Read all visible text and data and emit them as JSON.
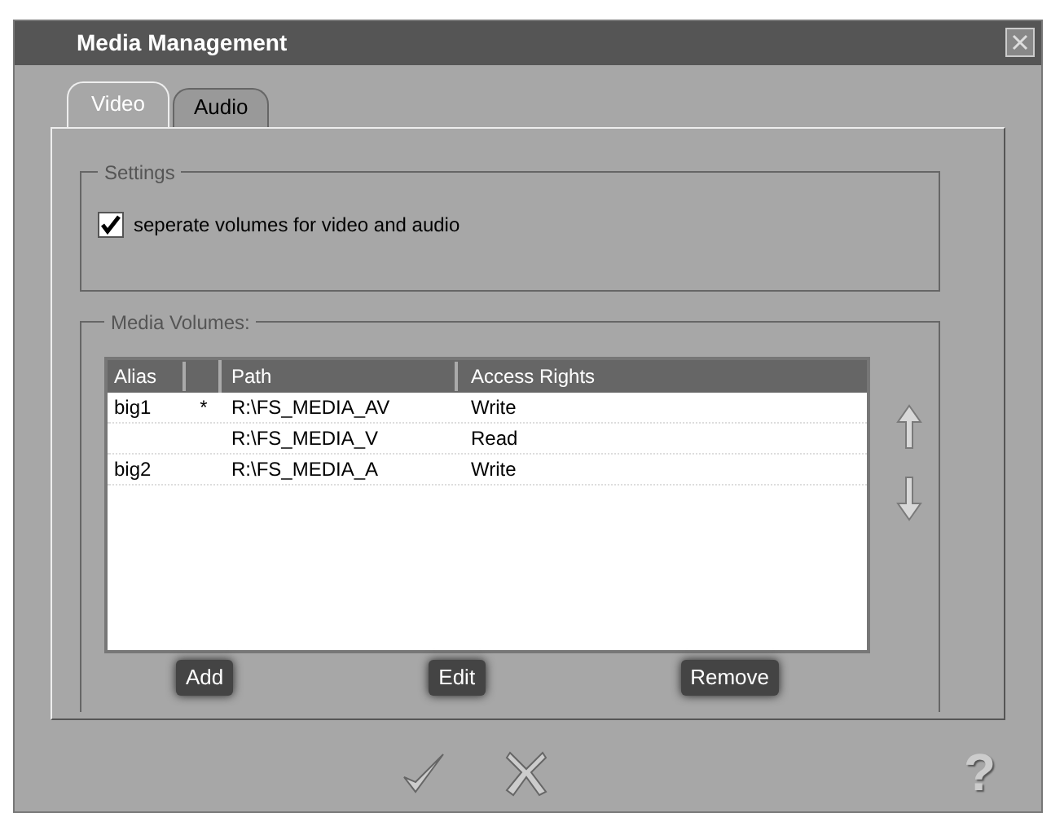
{
  "window": {
    "title": "Media Management"
  },
  "tabs": [
    {
      "label": "Video",
      "selected": true
    },
    {
      "label": "Audio",
      "selected": false
    }
  ],
  "settings": {
    "legend": "Settings",
    "checkbox": {
      "label": "seperate volumes for video and audio",
      "checked": true
    }
  },
  "volumes": {
    "legend": "Media Volumes:",
    "columns": [
      "Alias",
      "Path",
      "Access Rights"
    ],
    "rows": [
      {
        "alias": "big1",
        "mark": "*",
        "path": "R:\\FS_MEDIA_AV",
        "rights": "Write"
      },
      {
        "path": "R:\\FS_MEDIA_V",
        "rights": "Read"
      },
      {
        "alias": "big2",
        "path": "R:\\FS_MEDIA_A",
        "rights": "Write"
      }
    ],
    "buttons": [
      "Add",
      "Edit",
      "Remove"
    ]
  },
  "help": "?"
}
